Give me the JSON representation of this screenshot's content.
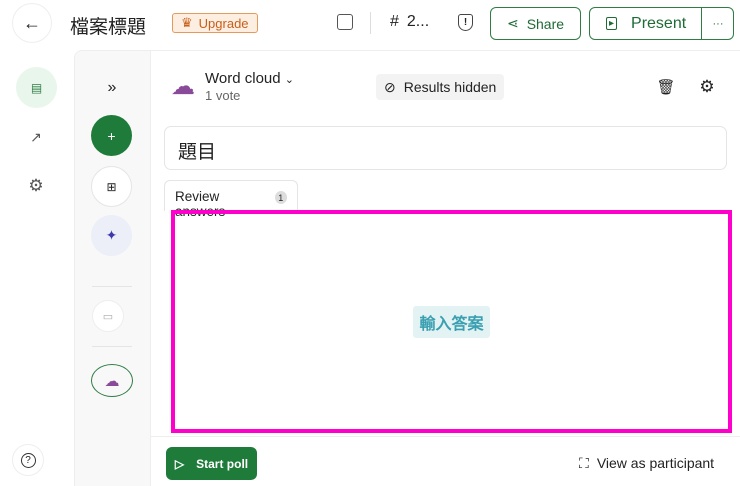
{
  "header": {
    "title": "檔案標題",
    "upgrade": "Upgrade",
    "count": "2...",
    "share": "Share",
    "present": "Present",
    "more": "···"
  },
  "slide": {
    "type": "Word cloud",
    "votes": "1 vote",
    "results": "Results hidden",
    "question": "題目",
    "tab": "Review answers",
    "tab_count": "1",
    "answer_placeholder": "輸入答案"
  },
  "footer": {
    "start": "Start poll",
    "view": "View as participant"
  },
  "colors": {
    "accent": "#1e7b3a",
    "highlight": "#ff00cc"
  }
}
